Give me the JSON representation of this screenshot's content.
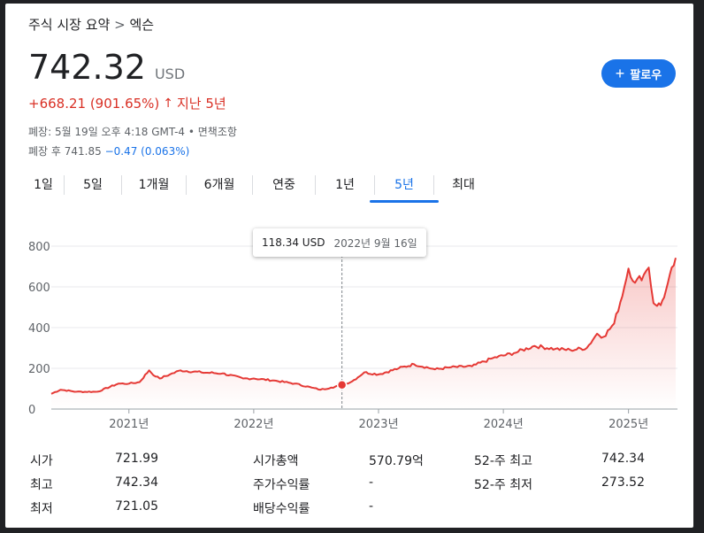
{
  "breadcrumb": {
    "parent": "주식 시장 요약",
    "separator": ">",
    "current": "엑슨"
  },
  "price": {
    "value": "742.32",
    "currency": "USD"
  },
  "change": {
    "amount": "+668.21 (901.65%)",
    "arrow": "↑",
    "period": "지난 5년"
  },
  "meta": {
    "closed": "폐장: 5월 19일 오후 4:18 GMT-4 • 면책조항",
    "after_hours_label": "폐장 후 741.85",
    "after_hours_change": "−0.47 (0.063%)"
  },
  "follow_button": {
    "icon": "plus-icon",
    "label": "팔로우"
  },
  "tabs": [
    {
      "label": "1일"
    },
    {
      "label": "5일"
    },
    {
      "label": "1개월"
    },
    {
      "label": "6개월"
    },
    {
      "label": "연중"
    },
    {
      "label": "1년"
    },
    {
      "label": "5년",
      "active": true
    },
    {
      "label": "최대"
    }
  ],
  "tooltip": {
    "price": "118.34 USD",
    "date": "2022년 9월 16일"
  },
  "colors": {
    "line": "#e53935",
    "accent": "#1a73e8",
    "negative": "#d93025"
  },
  "chart_data": {
    "type": "area",
    "y_ticks": [
      "800",
      "600",
      "400",
      "200",
      "0"
    ],
    "x_ticks": [
      "2021년",
      "2022년",
      "2023년",
      "2024년",
      "2025년"
    ],
    "ylim": [
      0,
      800
    ],
    "xlim": [
      "2020-05-19",
      "2025-05-19"
    ],
    "series": [
      {
        "x": [
          "2020-05-19",
          "2020-06-15",
          "2020-08-01",
          "2020-10-01",
          "2020-12-01",
          "2021-01-01",
          "2021-02-01",
          "2021-03-01",
          "2021-03-20",
          "2021-04-01",
          "2021-05-01",
          "2021-06-01",
          "2021-08-01",
          "2021-10-01",
          "2021-12-01",
          "2022-01-01",
          "2022-03-01",
          "2022-05-01",
          "2022-06-20",
          "2022-07-15",
          "2022-08-15",
          "2022-09-16",
          "2022-10-15",
          "2022-11-20",
          "2023-01-01",
          "2023-03-01",
          "2023-04-15",
          "2023-06-15",
          "2023-08-01",
          "2023-10-01",
          "2023-12-01",
          "2024-02-01",
          "2024-04-01",
          "2024-06-01",
          "2024-07-15",
          "2024-09-01",
          "2024-10-01",
          "2024-10-20",
          "2024-11-20",
          "2024-12-20",
          "2025-01-01",
          "2025-01-20",
          "2025-02-15",
          "2025-03-01",
          "2025-03-15",
          "2025-04-05",
          "2025-04-20",
          "2025-05-19"
        ],
        "y": [
          75,
          95,
          85,
          85,
          125,
          125,
          132,
          190,
          160,
          150,
          170,
          190,
          180,
          175,
          150,
          150,
          140,
          125,
          105,
          95,
          105,
          118,
          135,
          180,
          170,
          200,
          220,
          195,
          205,
          210,
          250,
          275,
          310,
          295,
          290,
          300,
          370,
          355,
          420,
          600,
          690,
          620,
          660,
          695,
          520,
          510,
          580,
          742
        ]
      }
    ]
  },
  "stats": [
    {
      "label": "시가",
      "value": "721.99"
    },
    {
      "label": "최고",
      "value": "742.34"
    },
    {
      "label": "최저",
      "value": "721.05"
    },
    {
      "label": "시가총액",
      "value": "570.79억"
    },
    {
      "label": "주가수익률",
      "value": "-"
    },
    {
      "label": "배당수익률",
      "value": "-"
    },
    {
      "label": "52-주 최고",
      "value": "742.34"
    },
    {
      "label": "52-주 최저",
      "value": "273.52"
    }
  ]
}
